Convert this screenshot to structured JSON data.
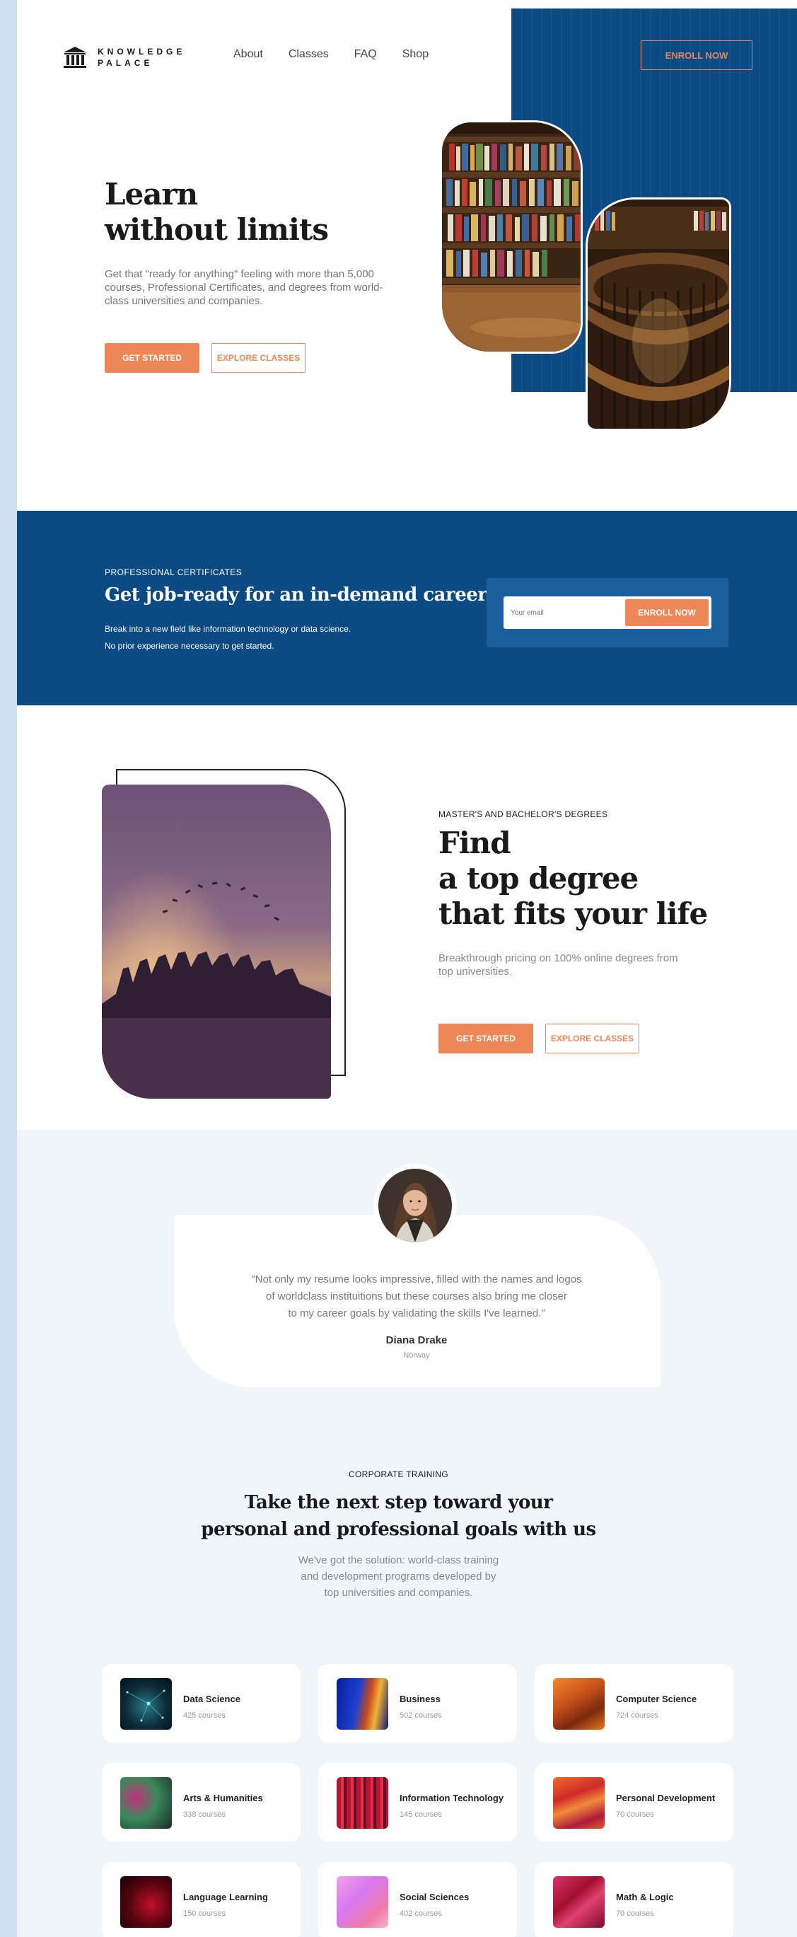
{
  "brand": {
    "line1": "KNOWLEDGE",
    "line2": "PALACE"
  },
  "nav": {
    "items": [
      "About",
      "Classes",
      "FAQ",
      "Shop"
    ],
    "cta": "ENROLL NOW"
  },
  "hero": {
    "title_line1": "Learn",
    "title_line2": "without limits",
    "description": "Get that \"ready for anything\" feeling with more than 5,000 courses, Professional Certificates, and degrees from world-class universities and companies.",
    "primary_button": "GET STARTED",
    "secondary_button": "EXPLORE CLASSES"
  },
  "certificates": {
    "kicker": "PROFESSIONAL CERTIFICATES",
    "title": "Get job-ready for an in-demand career",
    "desc_line1": "Break into a new field like information technology or data science.",
    "desc_line2": "No prior experience necessary to get started.",
    "email_placeholder": "Your email",
    "button": "ENROLL NOW"
  },
  "degrees": {
    "kicker": "MASTER'S AND BACHELOR'S DEGREES",
    "title_line1": "Find",
    "title_line2": "a top degree",
    "title_line3": "that fits your life",
    "description": "Breakthrough pricing on 100% online degrees from top universities.",
    "primary_button": "GET STARTED",
    "secondary_button": "EXPLORE CLASSES"
  },
  "testimonial": {
    "quote_line1": "\"Not only my resume looks impressive, filled with the names and logos",
    "quote_line2": "of worldclass instituitions but these courses also bring me closer",
    "quote_line3": "to my career goals by validating the skills I've learned.\"",
    "name": "Diana Drake",
    "country": "Norway"
  },
  "corporate": {
    "kicker": "CORPORATE TRAINING",
    "title_line1": "Take the next step toward your",
    "title_line2": "personal and professional goals with us",
    "desc_line1": "We've got the solution: world-class training",
    "desc_line2": "and development programs developed by",
    "desc_line3": "top universities and companies."
  },
  "categories": [
    {
      "name": "Data Science",
      "count": "425 courses"
    },
    {
      "name": "Business",
      "count": "502 courses"
    },
    {
      "name": "Computer Science",
      "count": "724 courses"
    },
    {
      "name": "Arts & Humanities",
      "count": "338 courses"
    },
    {
      "name": "Information Technology",
      "count": "145 courses"
    },
    {
      "name": "Personal Development",
      "count": "70 courses"
    },
    {
      "name": "Language Learning",
      "count": "150 courses"
    },
    {
      "name": "Social Sciences",
      "count": "402 courses"
    },
    {
      "name": "Math & Logic",
      "count": "70 courses"
    }
  ],
  "colors": {
    "primary_blue": "#0b4a82",
    "accent_orange": "#ee8757",
    "soft_bg": "#eff5fb"
  }
}
